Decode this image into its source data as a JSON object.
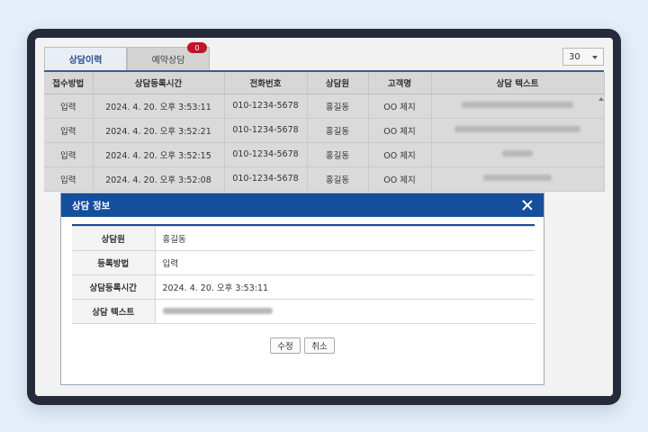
{
  "tabs": [
    {
      "label": "상담이력",
      "active": true
    },
    {
      "label": "예약상담",
      "badge": "0"
    }
  ],
  "page_size": "30",
  "grid": {
    "columns": [
      "접수방법",
      "상담등록시간",
      "전화번호",
      "상담원",
      "고객명",
      "상담 텍스트"
    ],
    "rows": [
      {
        "method": "입력",
        "time": "2024. 4. 20. 오후 3:53:11",
        "phone": "010-1234-5678",
        "agent": "홍길동",
        "customer": "OO 제지"
      },
      {
        "method": "입력",
        "time": "2024. 4. 20. 오후 3:52:21",
        "phone": "010-1234-5678",
        "agent": "홍길동",
        "customer": "OO 제지"
      },
      {
        "method": "입력",
        "time": "2024. 4. 20. 오후 3:52:15",
        "phone": "010-1234-5678",
        "agent": "홍길동",
        "customer": "OO 제지"
      },
      {
        "method": "입력",
        "time": "2024. 4. 20. 오후 3:52:08",
        "phone": "010-1234-5678",
        "agent": "홍길동",
        "customer": "OO 제지"
      }
    ]
  },
  "dialog": {
    "title": "상담 정보",
    "fields": [
      {
        "label": "상담원",
        "value": "홍길동"
      },
      {
        "label": "등록방법",
        "value": "입력"
      },
      {
        "label": "상담등록시간",
        "value": "2024. 4. 20. 오후 3:53:11"
      },
      {
        "label": "상담 텍스트",
        "value": ""
      }
    ],
    "edit_label": "수정",
    "cancel_label": "취소"
  },
  "colors": {
    "accent": "#154f9c",
    "badge": "#c0152a",
    "frame": "#252b3a",
    "background": "#e4eef9"
  }
}
